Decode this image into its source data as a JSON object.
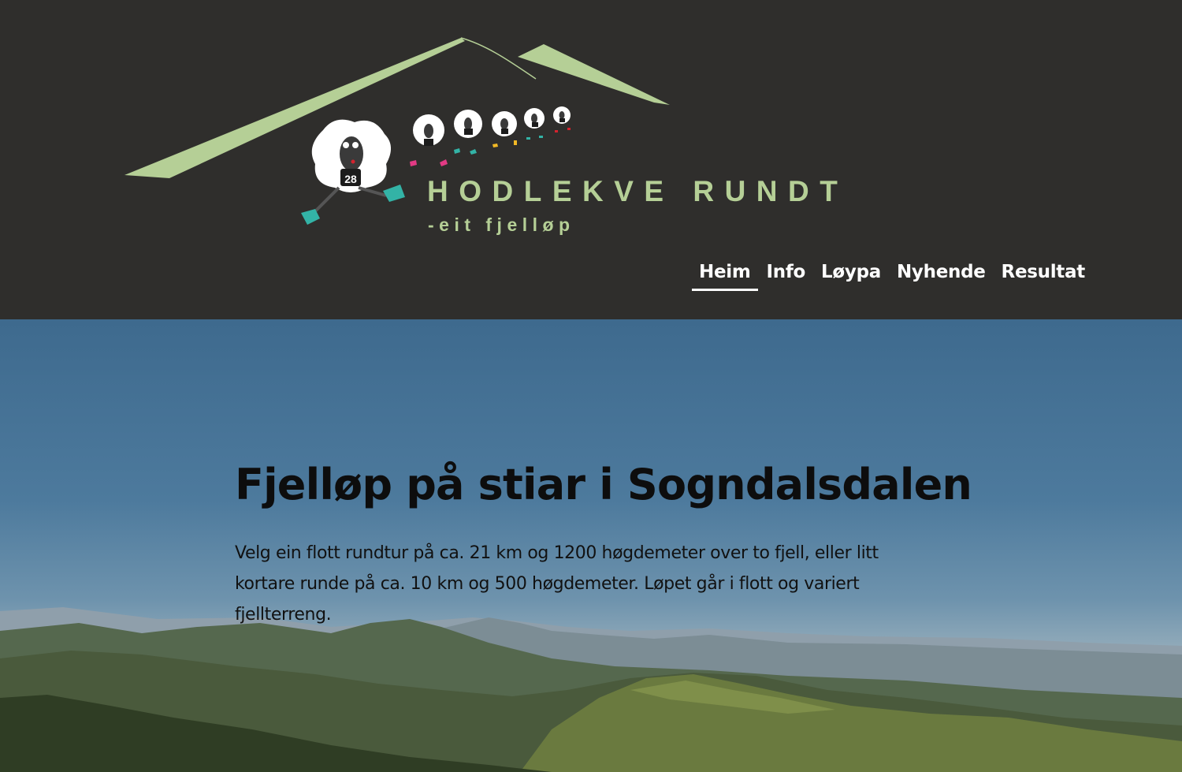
{
  "header": {
    "brand": {
      "title": "HODLEKVE RUNDT",
      "subtitle": "-eit fjelløp",
      "bib_number": "28"
    },
    "nav": [
      {
        "label": "Heim",
        "active": true
      },
      {
        "label": "Info",
        "active": false
      },
      {
        "label": "Løypa",
        "active": false
      },
      {
        "label": "Nyhende",
        "active": false
      },
      {
        "label": "Resultat",
        "active": false
      }
    ]
  },
  "hero": {
    "title": "Fjelløp på stiar i Sogndalsdalen",
    "text": "Velg ein flott rundtur på ca. 21 km og 1200 høgdemeter over to fjell, eller litt kortare runde på ca. 10 km og 500 høgdemeter. Løpet går i flott og variert fjellterreng."
  },
  "colors": {
    "header_bg": "#2f2e2c",
    "brand_green": "#b5cf96",
    "nav_text": "#ffffff"
  }
}
